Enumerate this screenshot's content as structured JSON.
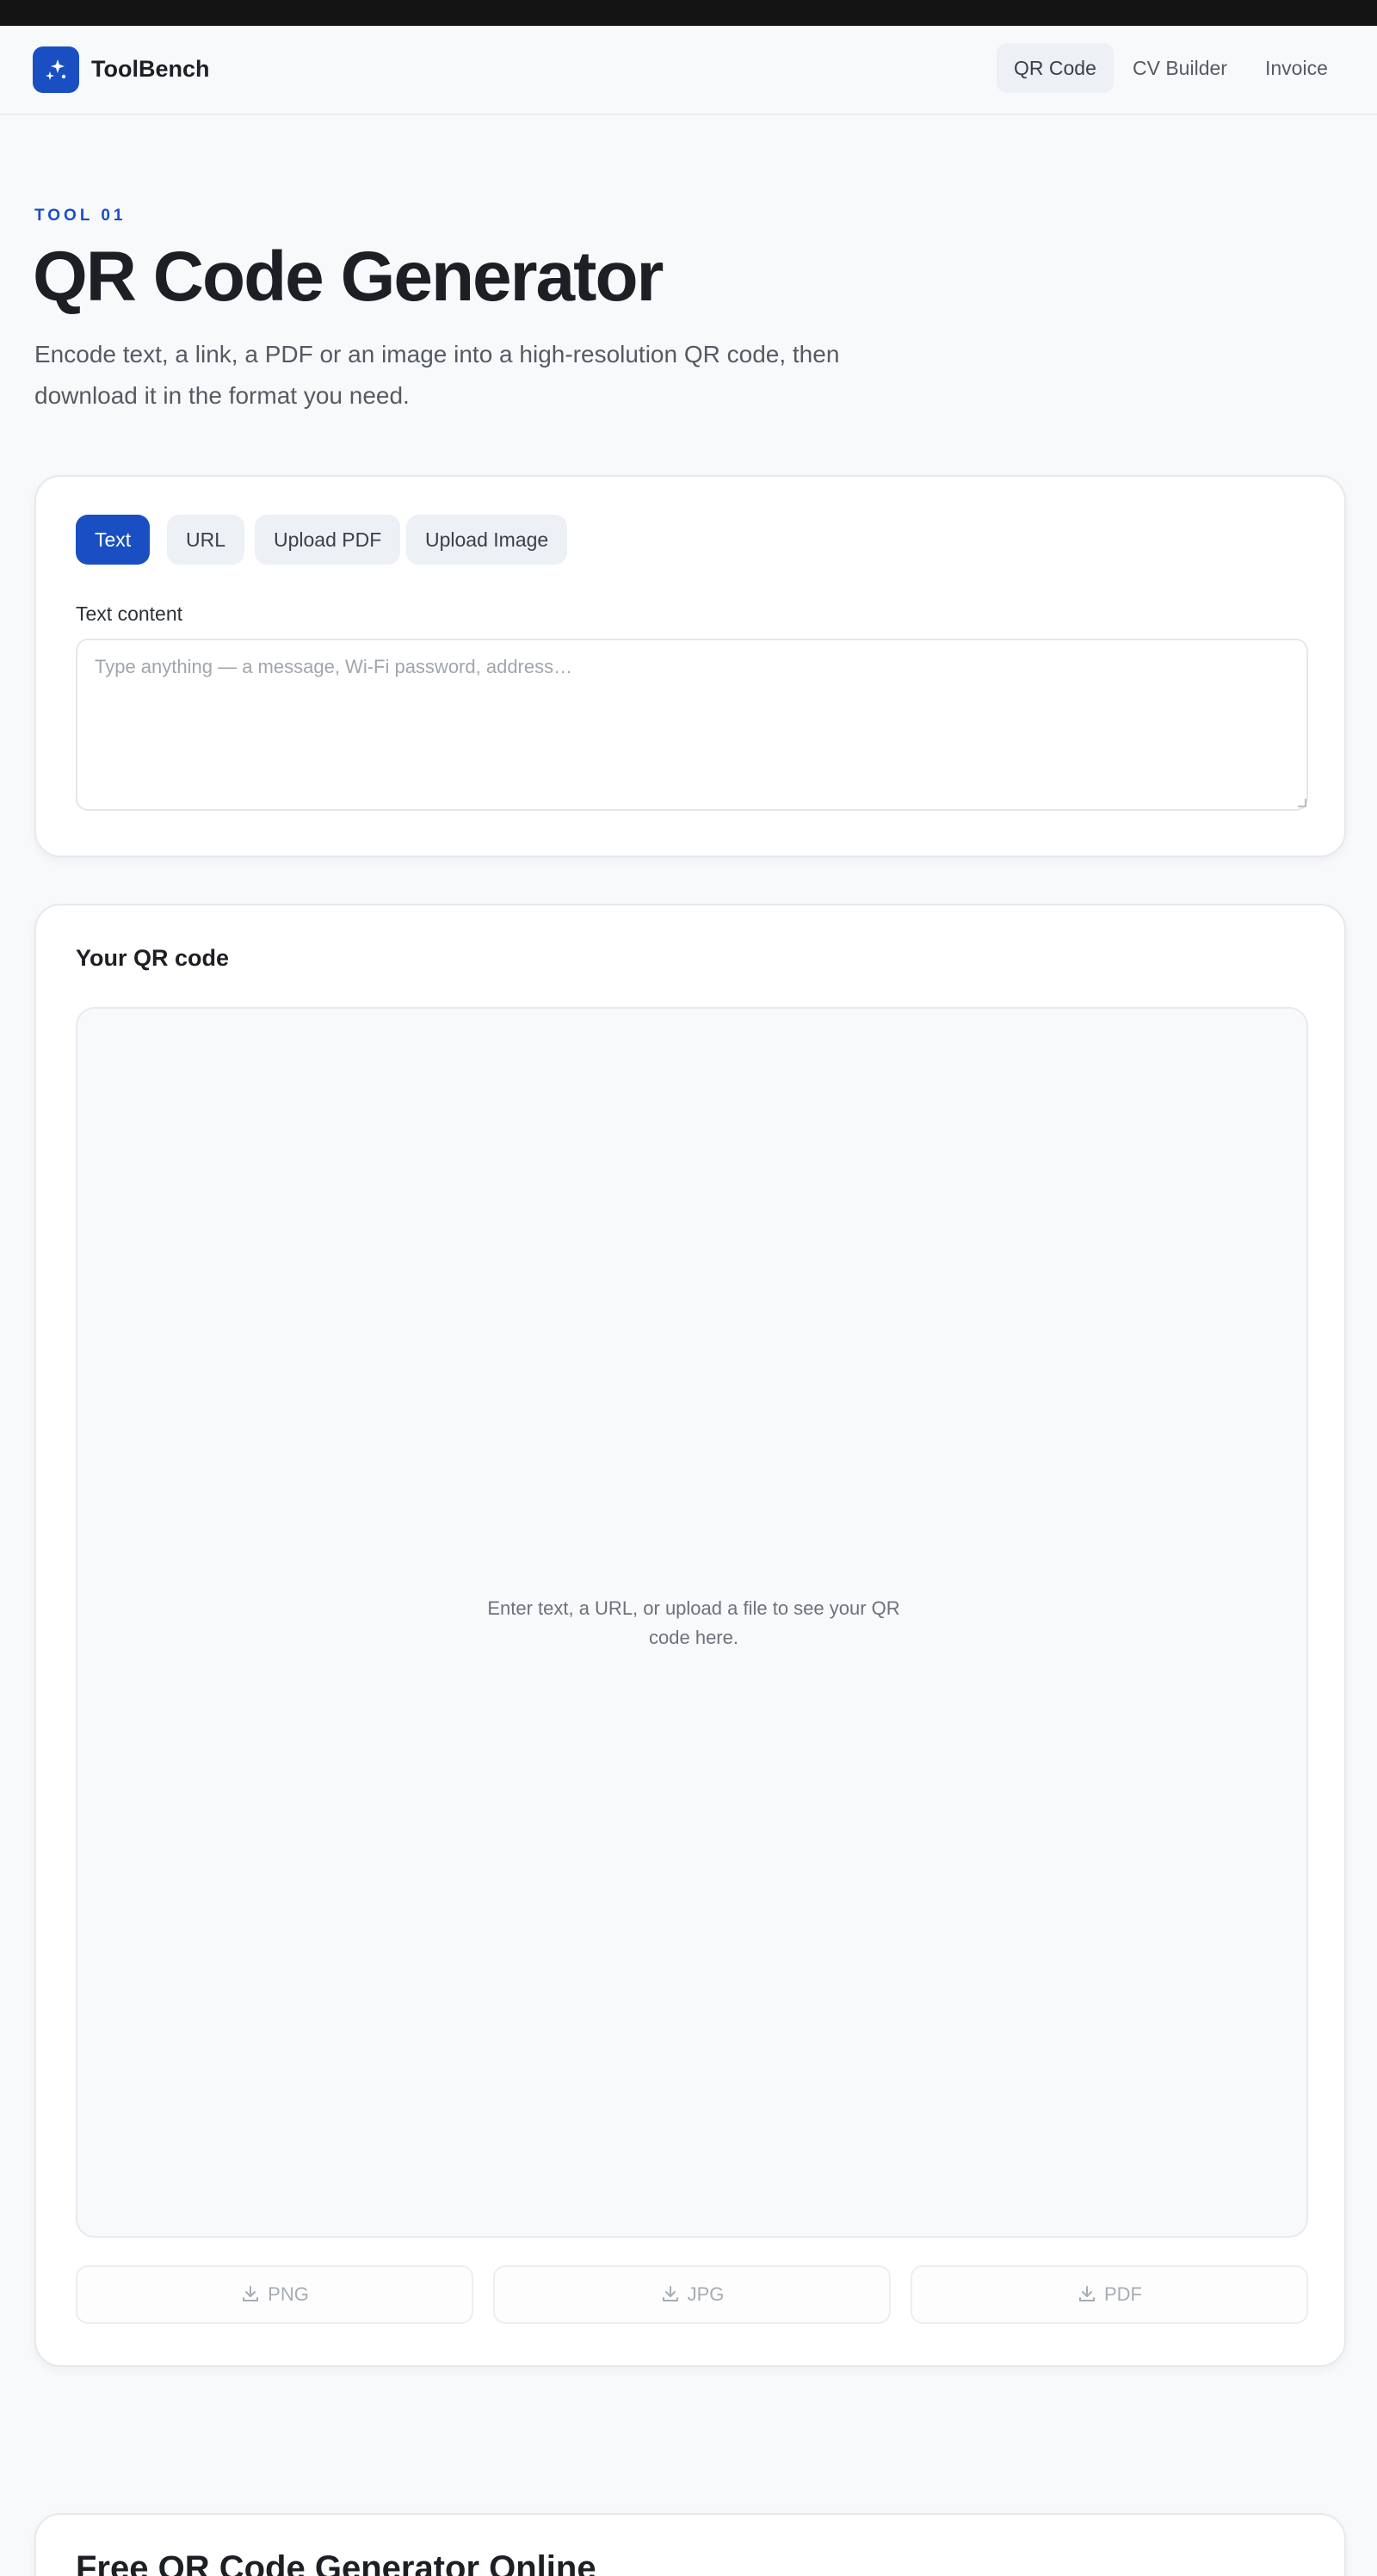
{
  "header": {
    "brand": "ToolBench",
    "nav": [
      {
        "label": "QR Code",
        "active": true
      },
      {
        "label": "CV Builder",
        "active": false
      },
      {
        "label": "Invoice",
        "active": false
      }
    ]
  },
  "hero": {
    "eyebrow": "TOOL 01",
    "title": "QR Code Generator",
    "subtitle": "Encode text, a link, a PDF or an image into a high-resolution QR code, then download it in the format you need."
  },
  "input_card": {
    "tabs": [
      "Text",
      "URL",
      "Upload PDF",
      "Upload Image"
    ],
    "active_tab": "Text",
    "field_label": "Text content",
    "field_value": "",
    "field_placeholder": "Type anything — a message, Wi-Fi password, address…"
  },
  "output_card": {
    "title": "Your QR code",
    "empty_message": "Enter text, a URL, or upload a file to see your QR code here.",
    "downloads": [
      "PNG",
      "JPG",
      "PDF"
    ]
  },
  "bottom_card": {
    "title": "Free QR Code Generator Online"
  },
  "colors": {
    "accent": "#1a4fc4",
    "background": "#f8f9fb",
    "card": "#ffffff"
  }
}
